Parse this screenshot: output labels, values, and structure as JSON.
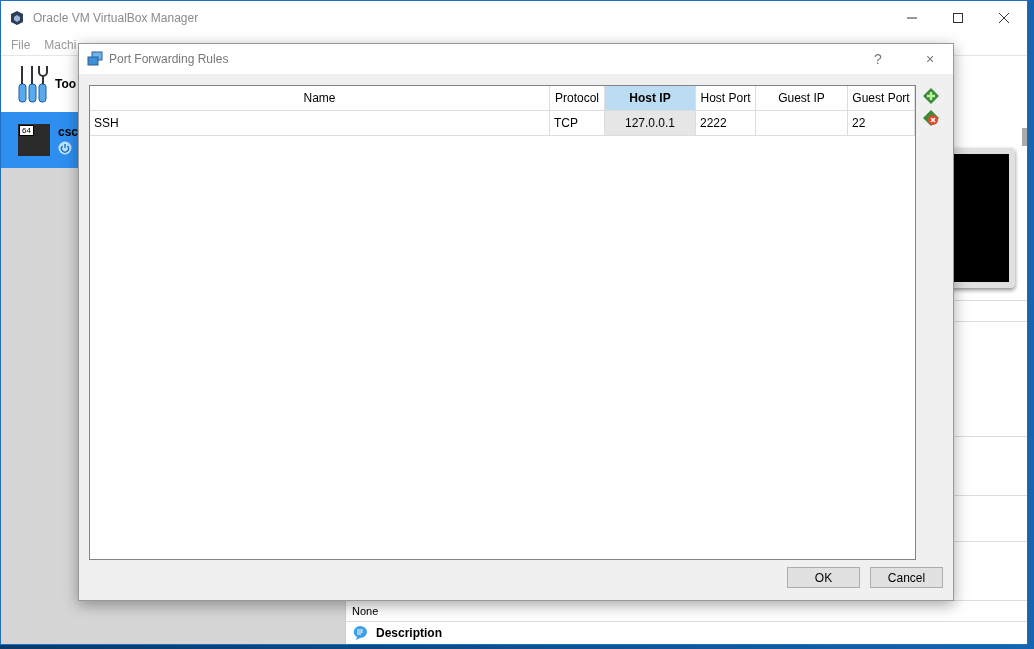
{
  "window": {
    "title": "Oracle VM VirtualBox Manager"
  },
  "menu": [
    "File",
    "Machi"
  ],
  "sidebar": {
    "tools_label": "Too",
    "vm": {
      "name": "csc",
      "badge": "64",
      "selected": true
    }
  },
  "details": {
    "value": "None",
    "section": "Description"
  },
  "dialog": {
    "title": "Port Forwarding Rules",
    "help": "?",
    "close": "×",
    "columns": [
      {
        "label": "Name",
        "selected": false
      },
      {
        "label": "Protocol",
        "selected": false
      },
      {
        "label": "Host IP",
        "selected": true
      },
      {
        "label": "Host Port",
        "selected": false
      },
      {
        "label": "Guest IP",
        "selected": false
      },
      {
        "label": "Guest Port",
        "selected": false
      }
    ],
    "rows": [
      {
        "cells": [
          "SSH",
          "TCP",
          "127.0.0.1",
          "2222",
          "",
          "22"
        ]
      }
    ],
    "buttons": [
      "OK",
      "Cancel"
    ]
  }
}
